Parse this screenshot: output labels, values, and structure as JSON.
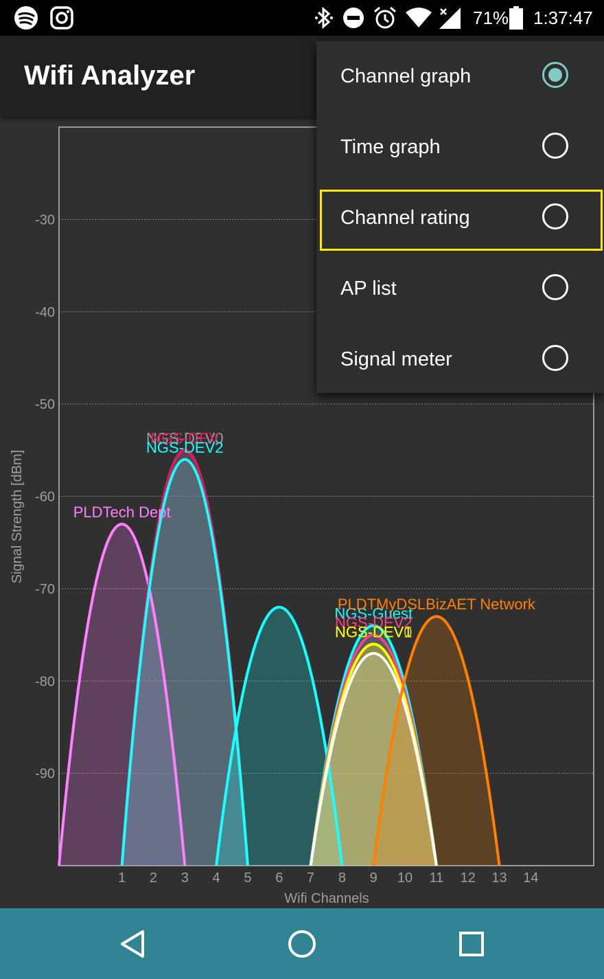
{
  "status_bar": {
    "battery_percent": "71%",
    "time": "1:37:47",
    "icons": [
      "spotify-icon",
      "instagram-icon",
      "bluetooth-icon",
      "do-not-disturb-icon",
      "alarm-icon",
      "wifi-icon",
      "cell-signal-icon",
      "battery-icon"
    ]
  },
  "app_bar": {
    "title": "Wifi Analyzer"
  },
  "menu": {
    "items": [
      {
        "label": "Channel graph",
        "checked": true
      },
      {
        "label": "Time graph",
        "checked": false
      },
      {
        "label": "Channel rating",
        "checked": false
      },
      {
        "label": "AP list",
        "checked": false
      },
      {
        "label": "Signal meter",
        "checked": false
      }
    ],
    "highlighted": "Channel rating"
  },
  "colors": {
    "accent": "#80cbc4",
    "highlight": "#ffeb00",
    "nav_bar": "#308494"
  },
  "chart_data": {
    "type": "area",
    "xlabel": "Wifi Channels",
    "ylabel": "Signal Strength [dBm]",
    "xlim": [
      -1,
      16
    ],
    "ylim": [
      -100,
      -20
    ],
    "x_ticks": [
      1,
      2,
      3,
      4,
      5,
      6,
      7,
      8,
      9,
      10,
      11,
      12,
      13,
      14
    ],
    "y_ticks": [
      -30,
      -40,
      -50,
      -60,
      -70,
      -80,
      -90
    ],
    "grid": true,
    "series": [
      {
        "name": "PLDTech Dept",
        "channel": 1,
        "signal": -63,
        "color": "#ff80ff"
      },
      {
        "name": "NGS-DEV0",
        "channel": 3,
        "signal": -55,
        "color": "#9e9e9e"
      },
      {
        "name": "NGS-DEV",
        "channel": 3,
        "signal": -55,
        "color": "#d81b60"
      },
      {
        "name": "NGS-DEV2",
        "channel": 3,
        "signal": -56,
        "color": "#18ffff"
      },
      {
        "name": "",
        "channel": 6,
        "signal": -72,
        "color": "#18ffff"
      },
      {
        "name": "NGS-Guest",
        "channel": 9,
        "signal": -74,
        "color": "#18ffff"
      },
      {
        "name": "NGS-DEV2",
        "channel": 9,
        "signal": -75,
        "color": "#ff4081"
      },
      {
        "name": "NGS-DEV0",
        "channel": 9,
        "signal": -76,
        "color": "#c0ca33"
      },
      {
        "name": "NGS-DEV1",
        "channel": 9,
        "signal": -76,
        "color": "#ffff00"
      },
      {
        "name": "",
        "channel": 9,
        "signal": -77,
        "color": "#ffffff"
      },
      {
        "name": "PLDTMyDSLBizAET Network",
        "channel": 11,
        "signal": -73,
        "color": "#ff8000"
      }
    ]
  }
}
